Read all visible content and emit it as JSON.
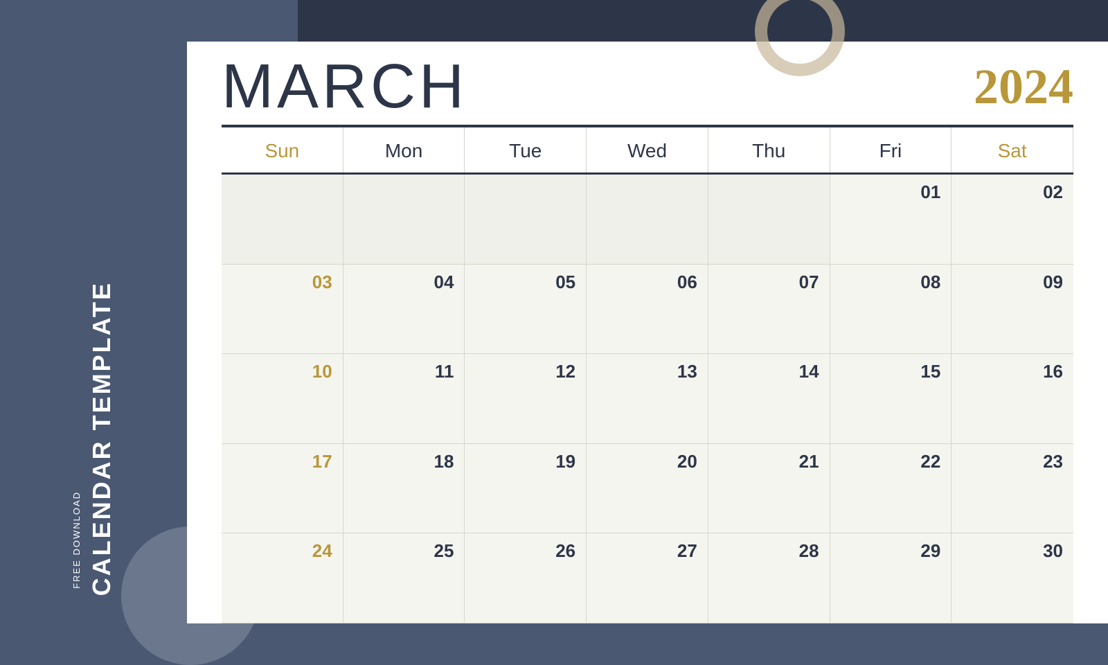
{
  "sidebar": {
    "free_download": "FREE DOWNLOAD",
    "calendar_template": "CALENDAR TEMPLATE"
  },
  "calendar": {
    "month": "MARCH",
    "year": "2024",
    "days_header": [
      "Sun",
      "Mon",
      "Tue",
      "Wed",
      "Thu",
      "Fri",
      "Sat"
    ],
    "weeks": [
      [
        {
          "date": "",
          "empty": true
        },
        {
          "date": "",
          "empty": true
        },
        {
          "date": "",
          "empty": true
        },
        {
          "date": "",
          "empty": true
        },
        {
          "date": "",
          "empty": true
        },
        {
          "date": "01",
          "gold": false
        },
        {
          "date": "02",
          "gold": false
        }
      ],
      [
        {
          "date": "03",
          "gold": true
        },
        {
          "date": "04",
          "gold": false
        },
        {
          "date": "05",
          "gold": false
        },
        {
          "date": "06",
          "gold": false
        },
        {
          "date": "07",
          "gold": false
        },
        {
          "date": "08",
          "gold": false
        },
        {
          "date": "09",
          "gold": false
        }
      ],
      [
        {
          "date": "10",
          "gold": true
        },
        {
          "date": "11",
          "gold": false
        },
        {
          "date": "12",
          "gold": false
        },
        {
          "date": "13",
          "gold": false
        },
        {
          "date": "14",
          "gold": false
        },
        {
          "date": "15",
          "gold": false
        },
        {
          "date": "16",
          "gold": false
        }
      ],
      [
        {
          "date": "17",
          "gold": true
        },
        {
          "date": "18",
          "gold": false
        },
        {
          "date": "19",
          "gold": false
        },
        {
          "date": "20",
          "gold": false
        },
        {
          "date": "21",
          "gold": false
        },
        {
          "date": "22",
          "gold": false
        },
        {
          "date": "23",
          "gold": false
        }
      ],
      [
        {
          "date": "24",
          "gold": true
        },
        {
          "date": "25",
          "gold": false
        },
        {
          "date": "26",
          "gold": false
        },
        {
          "date": "27",
          "gold": false
        },
        {
          "date": "28",
          "gold": false
        },
        {
          "date": "29",
          "gold": false
        },
        {
          "date": "30",
          "gold": false
        }
      ]
    ]
  },
  "colors": {
    "dark_navy": "#2d3548",
    "slate_blue": "#4a5872",
    "gold": "#b8973a",
    "light_gray_bg": "#f5f5ef",
    "cell_border": "#d4d8cc"
  }
}
